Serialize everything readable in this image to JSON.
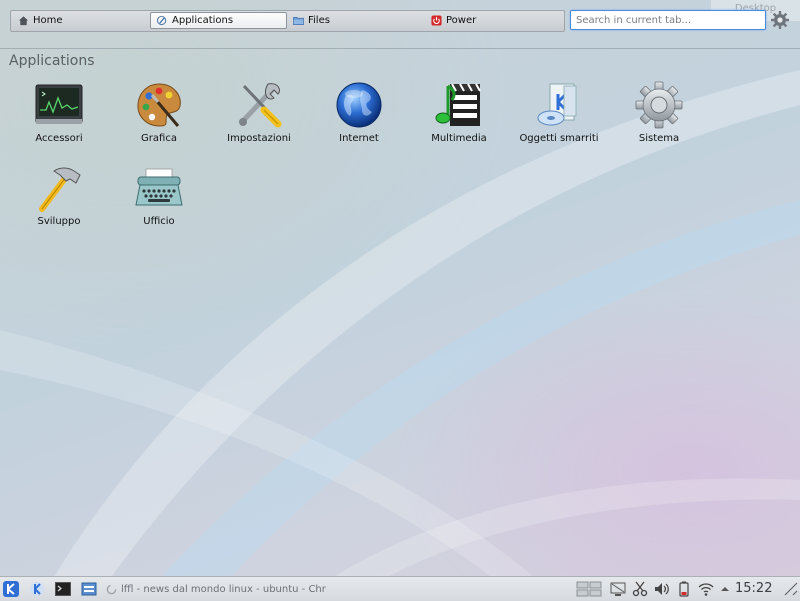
{
  "tabs": [
    {
      "label": "Home",
      "icon": "home-icon"
    },
    {
      "label": "Applications",
      "icon": "applications-icon"
    },
    {
      "label": "Files",
      "icon": "folder-icon"
    },
    {
      "label": "Power",
      "icon": "power-icon"
    }
  ],
  "active_tab": "Applications",
  "search": {
    "placeholder": "Search in current tab..."
  },
  "desktop_ghost": "Desktop",
  "section_title": "Applications",
  "apps": [
    {
      "label": "Accessori",
      "icon": "accessories-icon"
    },
    {
      "label": "Grafica",
      "icon": "graphics-palette-icon"
    },
    {
      "label": "Impostazioni",
      "icon": "settings-tools-icon"
    },
    {
      "label": "Internet",
      "icon": "globe-icon"
    },
    {
      "label": "Multimedia",
      "icon": "multimedia-icon"
    },
    {
      "label": "Oggetti smarriti",
      "icon": "lost-found-icon"
    },
    {
      "label": "Sistema",
      "icon": "system-gear-icon"
    },
    {
      "label": "Sviluppo",
      "icon": "development-hammer-icon"
    },
    {
      "label": "Ufficio",
      "icon": "office-typewriter-icon"
    }
  ],
  "taskbar": {
    "task_label": "lffl - news dal mondo linux - ubuntu - Chro",
    "clock": "15:22"
  },
  "colors": {
    "accent": "#4a8ad8",
    "power": "#d22a2a"
  }
}
